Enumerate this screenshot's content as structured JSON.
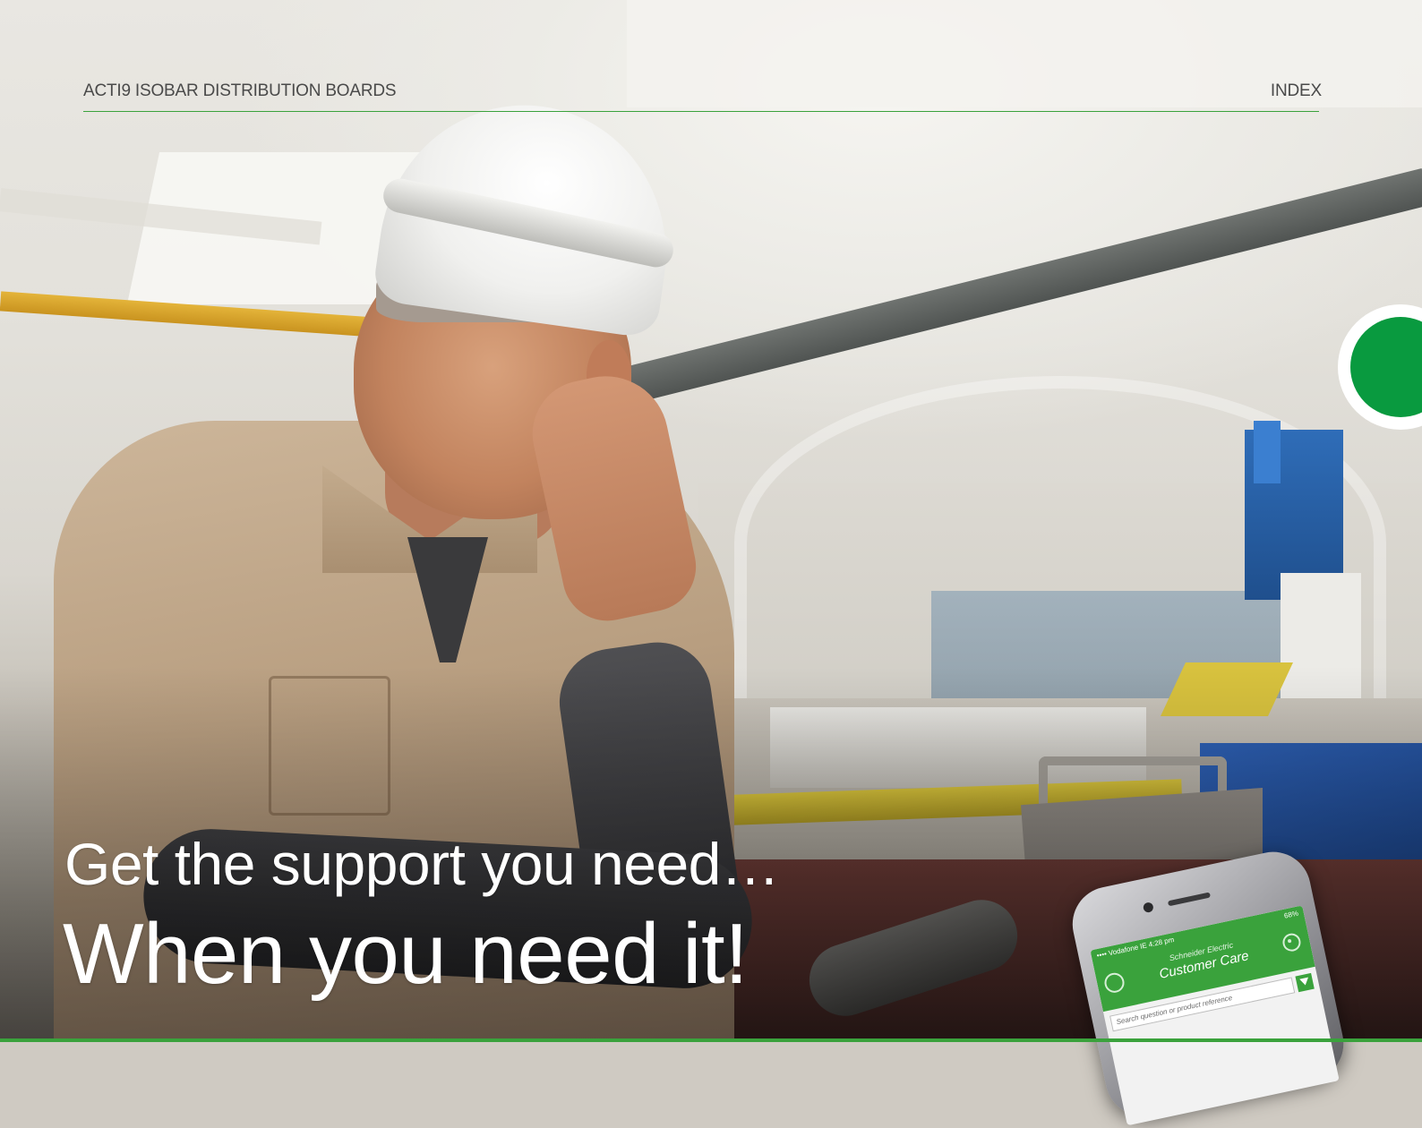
{
  "header": {
    "doc_title": "ACTI9 ISOBAR DISTRIBUTION BOARDS",
    "index_label": "INDEX"
  },
  "hero": {
    "headline_line1": "Get the support you need…",
    "headline_line2": "When you need it!"
  },
  "phone_app": {
    "status_left": "•••• Vodafone IE  4:28 pm",
    "status_right": "68%",
    "brand": "Schneider Electric",
    "title": "Customer Care",
    "search_placeholder": "Search question or product reference"
  },
  "colors": {
    "accent_green": "#3aa23c",
    "side_tab_green": "#099a3f",
    "header_text": "#4a4a4a",
    "headline_text": "#ffffff"
  },
  "icons": {
    "settings": "gear-icon",
    "filter": "filter-icon",
    "app_logo": "customer-care-logo-icon"
  }
}
